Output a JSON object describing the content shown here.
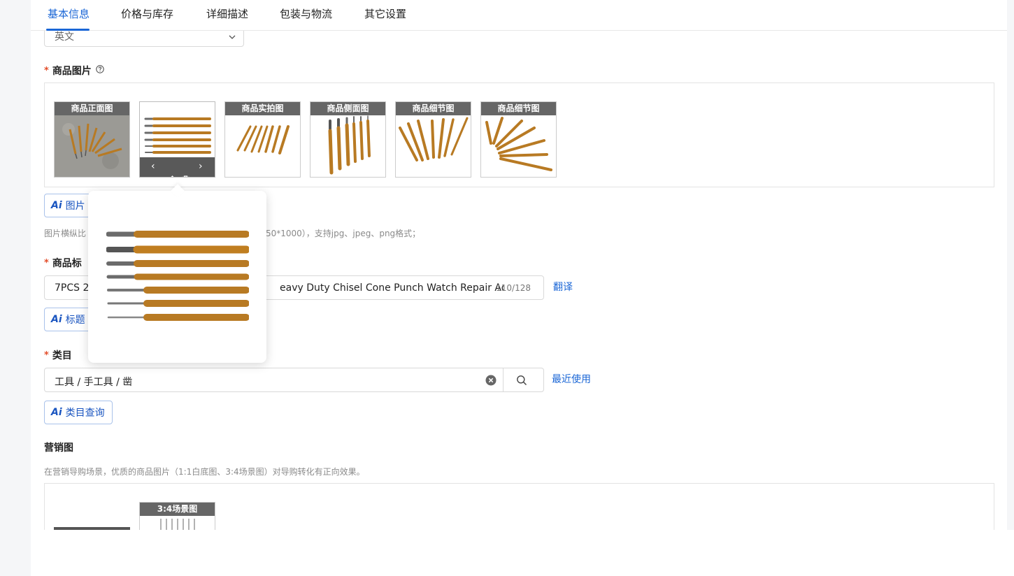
{
  "tabs": [
    {
      "label": "基本信息",
      "active": true
    },
    {
      "label": "价格与库存",
      "active": false
    },
    {
      "label": "详细描述",
      "active": false
    },
    {
      "label": "包装与物流",
      "active": false
    },
    {
      "label": "其它设置",
      "active": false
    }
  ],
  "language": {
    "value": "英文",
    "icon": "chevron-down-icon"
  },
  "product_images": {
    "label": "商品图片",
    "required_mark": "*",
    "help_icon": "question-circle-icon",
    "thumbnails": [
      {
        "caption": "商品正面图"
      },
      {
        "caption": ""
      },
      {
        "caption": "商品实拍图"
      },
      {
        "caption": "商品侧面图"
      },
      {
        "caption": "商品细节图"
      },
      {
        "caption": "商品细节图"
      }
    ],
    "hover_toolbar_icons": [
      "chevron-left-icon",
      "edit-icon",
      "trash-icon",
      "chevron-right-icon"
    ],
    "ai_button": "图片",
    "hint_left": "图片横纵比",
    "hint_right": "50*1000），支持jpg、jpeg、png格式；"
  },
  "product_title": {
    "label": "商品标",
    "required_mark": "*",
    "value_left": "7PCS 2",
    "value_right": "eavy Duty Chisel Cone Punch Watch Repair Acc",
    "counter": "110/128",
    "translate_link": "翻译",
    "ai_button": "标题"
  },
  "category": {
    "label": "类目",
    "required_mark": "*",
    "value": "工具 / 手工具 / 凿",
    "recent_link": "最近使用",
    "ai_button": "类目查询"
  },
  "marketing": {
    "label": "营销图",
    "hint": "在营销导购场景，优质的商品图片（1:1白底图、3:4场景图）对导购转化有正向效果。",
    "thumbnails": [
      {
        "caption": "3:4场景图"
      }
    ]
  },
  "colors": {
    "accent": "#1a66d6",
    "required": "#e34d2a",
    "wood": "#b87a23",
    "steel": "#6b6b6b"
  }
}
